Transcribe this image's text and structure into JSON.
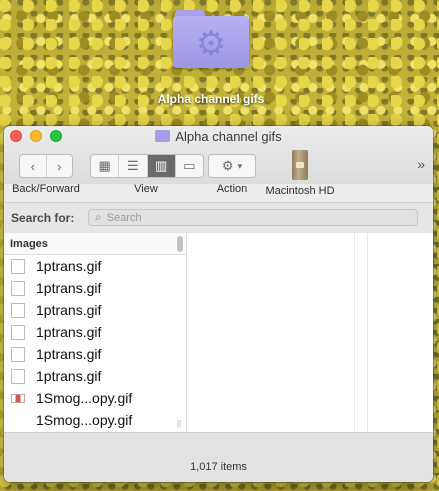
{
  "desktop": {
    "folder_label": "Alpha channel gifs"
  },
  "window": {
    "title": "Alpha channel gifs",
    "toolbar": {
      "back_forward_label": "Back/Forward",
      "view_label": "View",
      "action_label": "Action",
      "disk_label": "Macintosh HD",
      "more_label": "»"
    },
    "search": {
      "label": "Search for:",
      "placeholder": "Search"
    },
    "column": {
      "header": "Images",
      "files": [
        {
          "name": "1ptrans.gif",
          "icon": "blank-file-icon"
        },
        {
          "name": "1ptrans.gif",
          "icon": "blank-file-icon"
        },
        {
          "name": "1ptrans.gif",
          "icon": "blank-file-icon"
        },
        {
          "name": "1ptrans.gif",
          "icon": "blank-file-icon"
        },
        {
          "name": "1ptrans.gif",
          "icon": "blank-file-icon"
        },
        {
          "name": "1ptrans.gif",
          "icon": "blank-file-icon"
        },
        {
          "name": "1Smog...opy.gif",
          "icon": "image-file-icon"
        },
        {
          "name": "1Smog...opy.gif",
          "icon": "none"
        }
      ]
    },
    "status": {
      "item_count": "1,017 items"
    }
  },
  "colors": {
    "folder": "#a49de9",
    "close": "#fd5e55",
    "minimize": "#febc2d",
    "maximize": "#28c840"
  }
}
